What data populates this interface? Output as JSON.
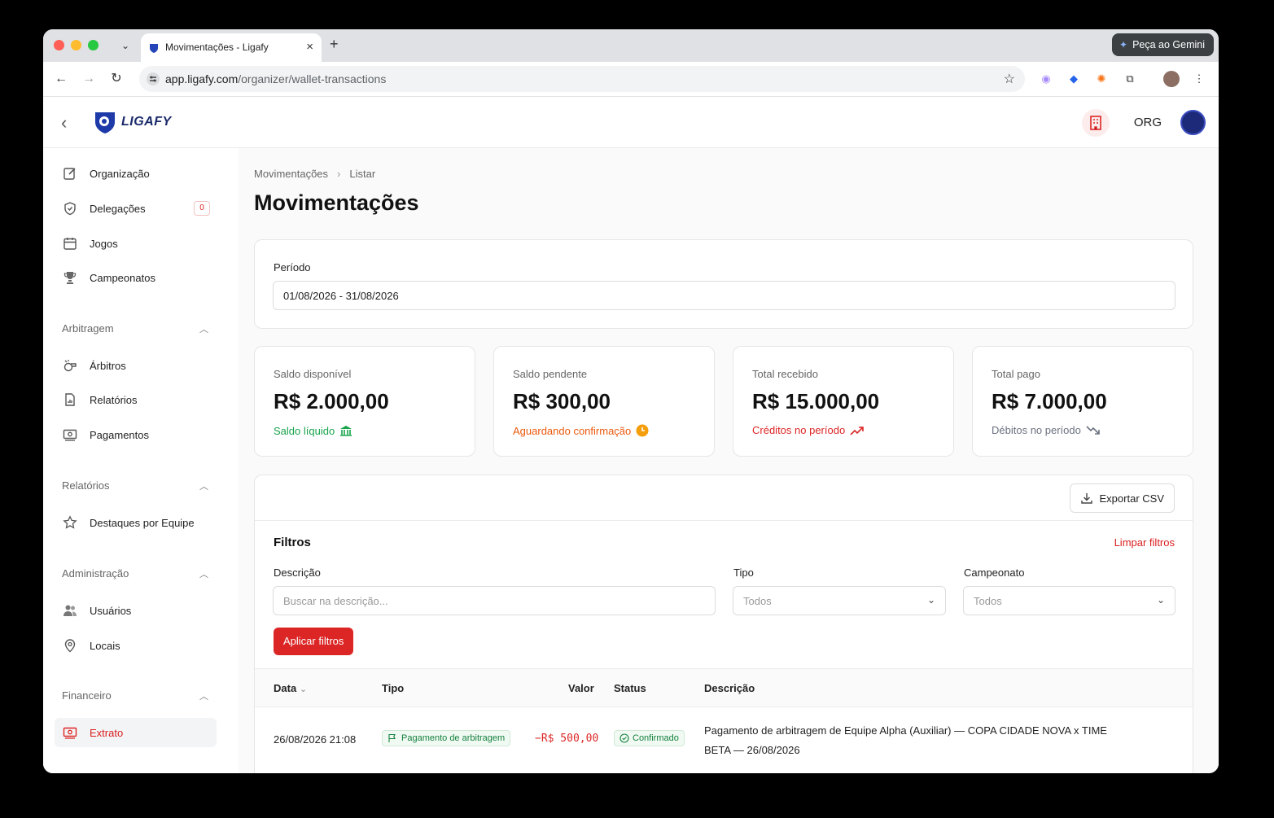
{
  "browser": {
    "tab_title": "Movimentações - Ligafy",
    "url_host": "app.ligafy.com",
    "url_path": "/organizer/wallet-transactions",
    "gemini_label": "Peça ao Gemini"
  },
  "header": {
    "logo_text": "LIGAFY",
    "org_label": "ORG"
  },
  "sidebar": {
    "items": [
      {
        "label": "Organização",
        "icon": "edit-icon"
      },
      {
        "label": "Delegações",
        "icon": "shield-icon",
        "badge": "0"
      },
      {
        "label": "Jogos",
        "icon": "calendar-icon"
      },
      {
        "label": "Campeonatos",
        "icon": "trophy-icon"
      }
    ],
    "groups": [
      {
        "label": "Arbitragem",
        "items": [
          {
            "label": "Árbitros",
            "icon": "whistle-icon"
          },
          {
            "label": "Relatórios",
            "icon": "report-icon"
          },
          {
            "label": "Pagamentos",
            "icon": "money-icon"
          }
        ]
      },
      {
        "label": "Relatórios",
        "items": [
          {
            "label": "Destaques por Equipe",
            "icon": "star-icon"
          }
        ]
      },
      {
        "label": "Administração",
        "items": [
          {
            "label": "Usuários",
            "icon": "users-icon"
          },
          {
            "label": "Locais",
            "icon": "location-icon"
          }
        ]
      },
      {
        "label": "Financeiro",
        "items": [
          {
            "label": "Extrato",
            "icon": "money-icon",
            "active": true
          }
        ]
      }
    ]
  },
  "breadcrumb": [
    "Movimentações",
    "Listar"
  ],
  "page_title": "Movimentações",
  "period": {
    "label": "Período",
    "value": "01/08/2026 - 31/08/2026"
  },
  "stats": [
    {
      "label": "Saldo disponível",
      "value": "R$ 2.000,00",
      "sub": "Saldo líquido",
      "color": "#16a34a",
      "icon": "bank-icon"
    },
    {
      "label": "Saldo pendente",
      "value": "R$ 300,00",
      "sub": "Aguardando confirmação",
      "color": "#ea580c",
      "icon": "clock-icon"
    },
    {
      "label": "Total recebido",
      "value": "R$ 15.000,00",
      "sub": "Créditos no período",
      "color": "#dc2626",
      "icon": "trend-up-icon"
    },
    {
      "label": "Total pago",
      "value": "R$ 7.000,00",
      "sub": "Débitos no período",
      "color": "#6b7280",
      "icon": "trend-down-icon"
    }
  ],
  "table": {
    "export_label": "Exportar CSV",
    "filters_title": "Filtros",
    "clear_label": "Limpar filtros",
    "desc_label": "Descrição",
    "desc_placeholder": "Buscar na descrição...",
    "tipo_label": "Tipo",
    "tipo_value": "Todos",
    "camp_label": "Campeonato",
    "camp_value": "Todos",
    "apply_label": "Aplicar filtros",
    "columns": [
      "Data",
      "Tipo",
      "Valor",
      "Status",
      "Descrição"
    ],
    "rows": [
      {
        "data": "26/08/2026 21:08",
        "tipo": "Pagamento de arbitragem",
        "valor": "−R$ 500,00",
        "status": "Confirmado",
        "descricao": "Pagamento de arbitragem de Equipe Alpha (Auxiliar) — COPA CIDADE NOVA x TIME BETA — 26/08/2026"
      }
    ]
  }
}
